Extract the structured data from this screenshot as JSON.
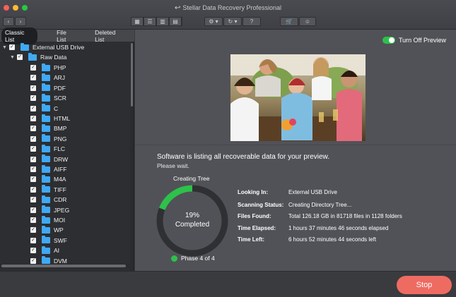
{
  "window": {
    "title": "Stellar Data Recovery Professional"
  },
  "toolbar": {
    "nav_back_icon": "chevron-left-icon",
    "nav_forward_icon": "chevron-right-icon",
    "view_icons": [
      "grid-view-icon",
      "list-view-icon",
      "column-view-icon",
      "cover-flow-icon"
    ],
    "settings_icon": "gear-icon",
    "history_icon": "history-icon",
    "help_label": "?",
    "cart_icon": "cart-icon",
    "account_icon": "user-icon"
  },
  "tabs": [
    {
      "label": "Classic List",
      "active": true
    },
    {
      "label": "File List",
      "active": false
    },
    {
      "label": "Deleted List",
      "active": false
    }
  ],
  "tree": {
    "root": "External USB Drive",
    "group": "Raw Data",
    "items": [
      "PHP",
      "ARJ",
      "PDF",
      "SCR",
      "C",
      "HTML",
      "BMP",
      "PNG",
      "FLC",
      "DRW",
      "AIFF",
      "M4A",
      "TIFF",
      "CDR",
      "JPEG",
      "MOI",
      "WP",
      "SWF",
      "AI",
      "DVM"
    ]
  },
  "preview": {
    "toggle_label": "Turn Off Preview",
    "toggle_on": true
  },
  "status": {
    "message": "Software is listing all recoverable data for your preview.",
    "sub": "Please wait.",
    "ring_title": "Creating Tree",
    "percent": "19%",
    "percent_value": 0.19,
    "percent_label": "Completed",
    "phase": "Phase 4 of 4"
  },
  "info": [
    {
      "label": "Looking In:",
      "value": "External USB Drive"
    },
    {
      "label": "Scanning Status:",
      "value": "Creating Directory Tree..."
    },
    {
      "label": "Files Found:",
      "value": "Total 126.18 GB in 81718 files in 1128 folders"
    },
    {
      "label": "Time Elapsed:",
      "value": "1 hours 37 minutes 46 seconds elapsed"
    },
    {
      "label": "Time Left:",
      "value": "6 hours 52 minutes 44 seconds left"
    }
  ],
  "actions": {
    "stop_label": "Stop"
  },
  "colors": {
    "accent_green": "#2ec14b",
    "folder_blue": "#3fa9f5",
    "stop_red": "#ee6b62"
  }
}
